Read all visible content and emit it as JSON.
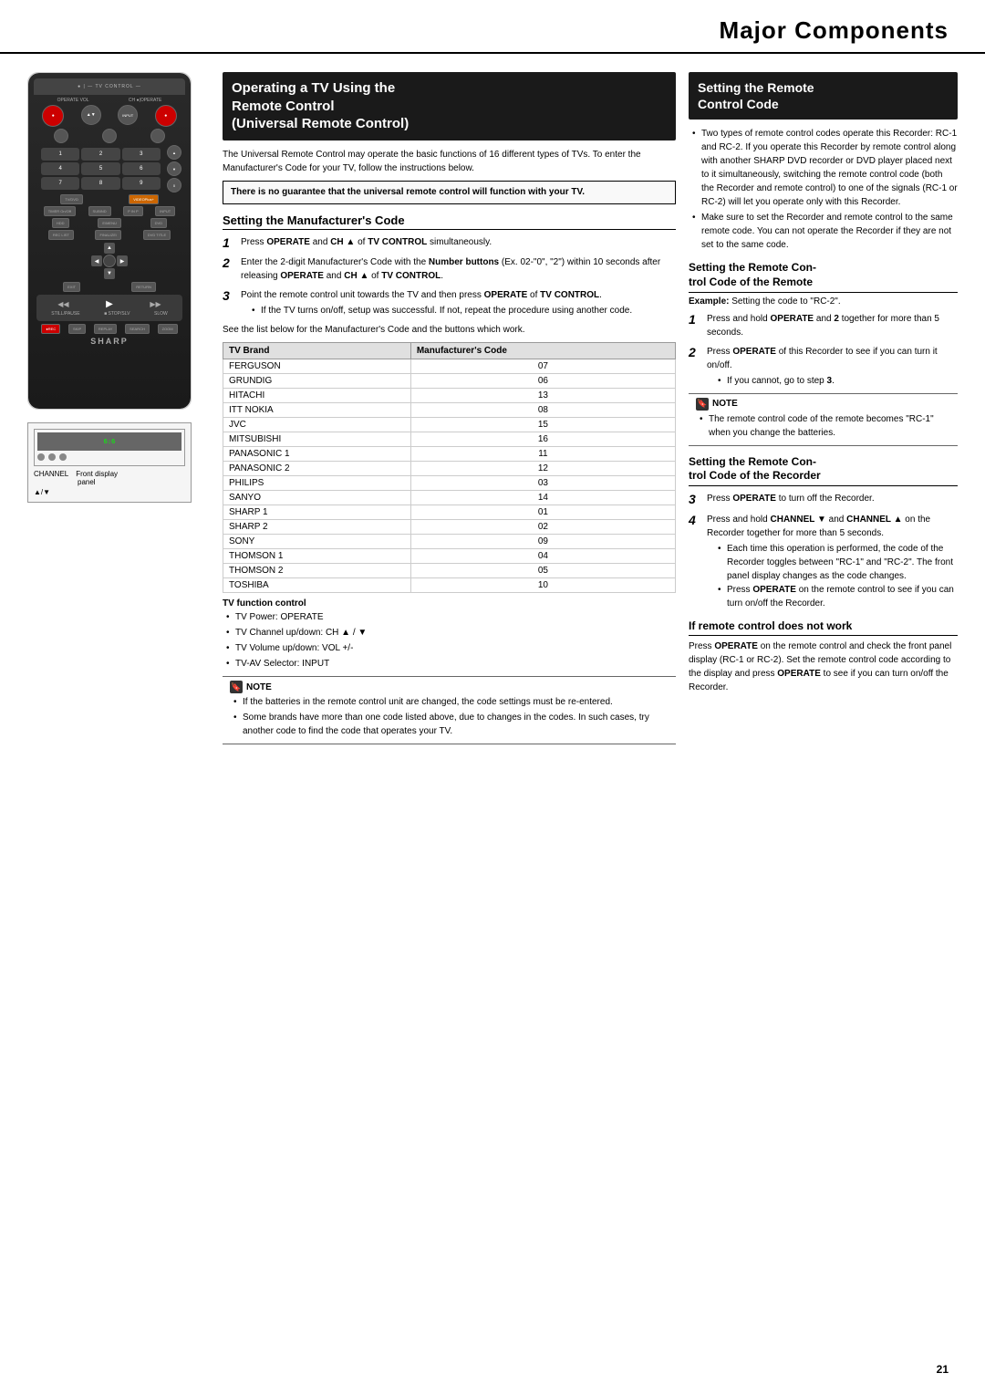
{
  "header": {
    "title": "Major Components"
  },
  "left": {
    "channel_label": "CHANNEL",
    "front_display_label": "Front display",
    "panel_label": "panel",
    "arrows": "▲/▼"
  },
  "mid": {
    "section_title_line1": "Operating a TV Using the",
    "section_title_line2": "Remote Control",
    "section_title_line3": "(Universal Remote Control)",
    "intro_text": "The Universal Remote Control may operate the basic functions of 16 different types of TVs. To enter the Manufacturer's Code for your TV, follow the instructions below.",
    "warning_text": "There is no guarantee that the universal remote control will function with your TV.",
    "mfr_code_title": "Setting the Manufacturer's Code",
    "step1_text": "Press OPERATE and CH ▲ of TV CONTROL simultaneously.",
    "step2_text": "Enter the 2-digit Manufacturer's Code with the Number buttons (Ex. 02-\"0\", \"2\") within 10 seconds after releasing OPERATE and CH ▲ of TV CONTROL.",
    "step3_text": "Point the remote control unit towards the TV and then press OPERATE of TV CONTROL.",
    "step3_bullet1": "If the TV turns on/off, setup was successful. If not, repeat the procedure using another code.",
    "table_note": "See the list below for the Manufacturer's Code and the buttons which work.",
    "table_header_brand": "TV Brand",
    "table_header_code": "Manufacturer's Code",
    "tv_brands": [
      {
        "brand": "FERGUSON",
        "code": "07"
      },
      {
        "brand": "GRUNDIG",
        "code": "06"
      },
      {
        "brand": "HITACHI",
        "code": "13"
      },
      {
        "brand": "ITT NOKIA",
        "code": "08"
      },
      {
        "brand": "JVC",
        "code": "15"
      },
      {
        "brand": "MITSUBISHI",
        "code": "16"
      },
      {
        "brand": "PANASONIC 1",
        "code": "11"
      },
      {
        "brand": "PANASONIC 2",
        "code": "12"
      },
      {
        "brand": "PHILIPS",
        "code": "03"
      },
      {
        "brand": "SANYO",
        "code": "14"
      },
      {
        "brand": "SHARP 1",
        "code": "01"
      },
      {
        "brand": "SHARP 2",
        "code": "02"
      },
      {
        "brand": "SONY",
        "code": "09"
      },
      {
        "brand": "THOMSON 1",
        "code": "04"
      },
      {
        "brand": "THOMSON 2",
        "code": "05"
      },
      {
        "brand": "TOSHIBA",
        "code": "10"
      }
    ],
    "tv_function_title": "TV function control",
    "tv_bullets": [
      "TV Power: OPERATE",
      "TV Channel up/down: CH ▲ / ▼",
      "TV Volume up/down: VOL +/-",
      "TV-AV Selector: INPUT"
    ],
    "note_title": "NOTE",
    "note_bullets": [
      "If the batteries in the remote control unit are changed, the code settings must be re-entered.",
      "Some brands have more than one code listed above, due to changes in the codes. In such cases, try another code to find the code that operates your TV."
    ]
  },
  "right": {
    "section1_title_line1": "Setting the Remote",
    "section1_title_line2": "Control Code",
    "section1_bullet1": "Two types of remote control codes operate this Recorder: RC-1 and RC-2. If you operate this Recorder by remote control along with another SHARP DVD recorder or DVD player placed next to it simultaneously, switching the remote control code (both the Recorder and remote control) to one of the signals (RC-1 or RC-2) will let you operate only with this Recorder.",
    "section1_bullet2": "Make sure to set the Recorder and remote control to the same remote code. You can not operate the Recorder if they are not set to the same code.",
    "section2_title": "Setting the Remote Control Code of the Remote",
    "example_label": "Example:",
    "example_text": "Setting the code to \"RC-2\".",
    "step1_text": "Press and hold OPERATE and 2 together for more than 5 seconds.",
    "step2_text": "Press OPERATE of this Recorder to see if you can turn it on/off.",
    "step2_bullet": "If you cannot, go to step 3.",
    "note2_title": "NOTE",
    "note2_bullet": "The remote control code of the remote becomes \"RC-1\" when you change the batteries.",
    "section3_title": "Setting the Remote Control Code of the Recorder",
    "step3_text": "Press OPERATE to turn off the Recorder.",
    "step4_text": "Press and hold CHANNEL ▼ and CHANNEL ▲ on the Recorder together for more than 5 seconds.",
    "step4_bullet1": "Each time this operation is performed, the code of the Recorder toggles between \"RC-1\" and \"RC-2\". The front panel display changes as the code changes.",
    "step4_bullet2": "Press OPERATE on the remote control to see if you can turn on/off the Recorder.",
    "section4_title": "If remote control does not work",
    "section4_text": "Press OPERATE on the remote control and check the front panel display (RC-1 or RC-2). Set the remote control code according to the display and press OPERATE to see if you can turn on/off the Recorder.",
    "page_number": "21"
  }
}
